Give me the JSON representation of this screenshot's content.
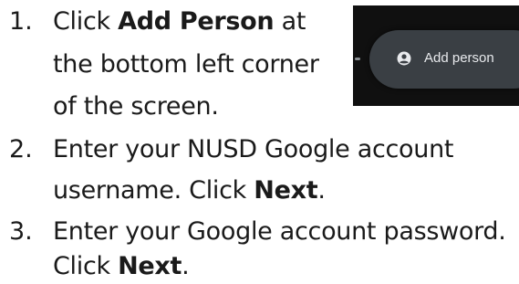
{
  "steps": [
    {
      "number": "1.",
      "lines": [
        {
          "pre": "Click ",
          "bold": "Add Person",
          "post": " at"
        },
        {
          "text": "the bottom left corner"
        },
        {
          "text": "of the screen."
        }
      ]
    },
    {
      "number": "2.",
      "lines": [
        {
          "text": "Enter your NUSD Google account"
        },
        {
          "pre": "username. Click ",
          "bold": "Next",
          "post": "."
        }
      ]
    },
    {
      "number": "3.",
      "lines": [
        {
          "text": "Enter your Google account password."
        },
        {
          "pre": "Click ",
          "bold": "Next",
          "post": "."
        }
      ]
    }
  ],
  "inset": {
    "button_label": "Add person",
    "icon": "add-person-icon",
    "colors": {
      "background": "#101010",
      "pill": "#3a3f44",
      "text": "#e8eaed"
    }
  }
}
